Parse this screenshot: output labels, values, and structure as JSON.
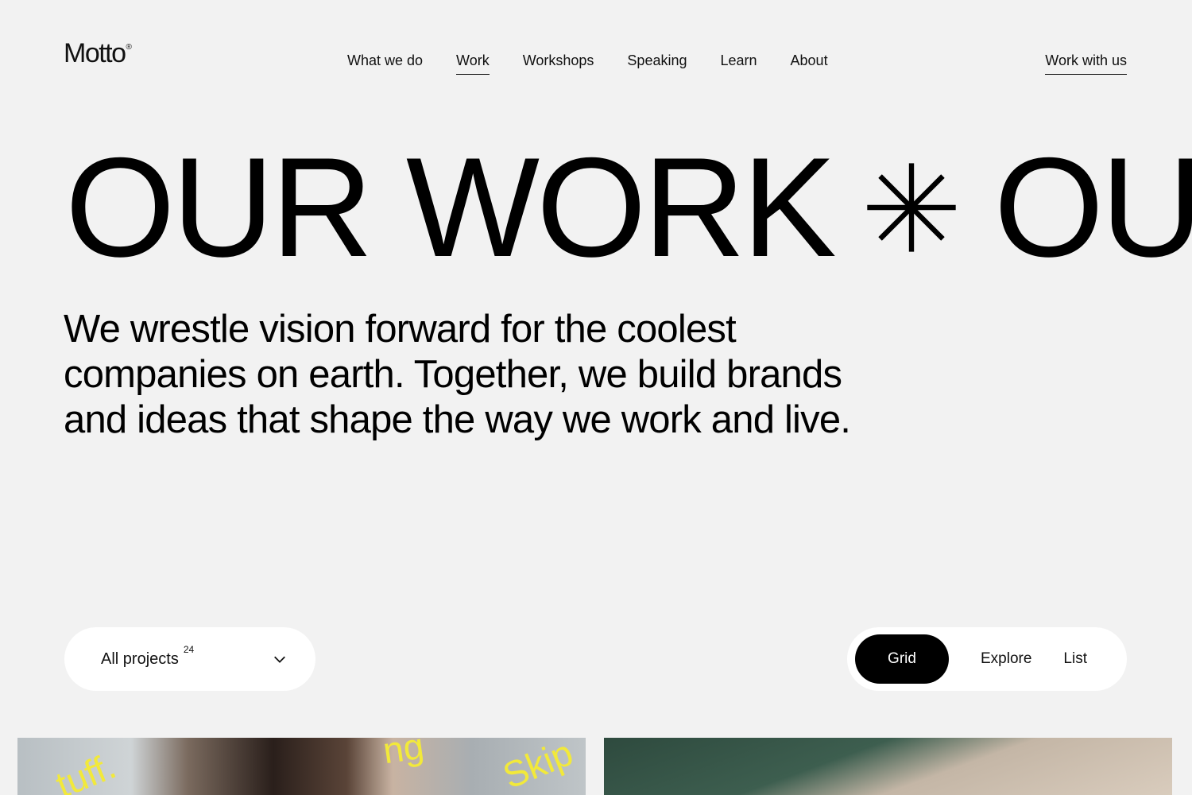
{
  "brand": {
    "name": "Motto",
    "mark": "®"
  },
  "nav": {
    "items": [
      {
        "label": "What we do",
        "active": false
      },
      {
        "label": "Work",
        "active": true
      },
      {
        "label": "Workshops",
        "active": false
      },
      {
        "label": "Speaking",
        "active": false
      },
      {
        "label": "Learn",
        "active": false
      },
      {
        "label": "About",
        "active": false
      }
    ],
    "cta": "Work with us"
  },
  "hero": {
    "marquee_word_1": "OUR WORK",
    "marquee_word_2": "OUR",
    "intro": "We wrestle vision forward for the coolest companies on earth. Together, we build brands and ideas that shape the way we work and live."
  },
  "filter": {
    "label": "All projects",
    "count": "24",
    "icon": "chevron-down-icon"
  },
  "view_switch": {
    "options": [
      {
        "label": "Grid",
        "active": true
      },
      {
        "label": "Explore",
        "active": false
      },
      {
        "label": "List",
        "active": false
      }
    ]
  },
  "thumbnails": {
    "left_overlay_1": "tuff.",
    "left_overlay_2": "ng",
    "left_overlay_3": "Skip"
  },
  "colors": {
    "background": "#f2f2f2",
    "text": "#000000",
    "pill": "#ffffff",
    "active_pill": "#000000"
  }
}
